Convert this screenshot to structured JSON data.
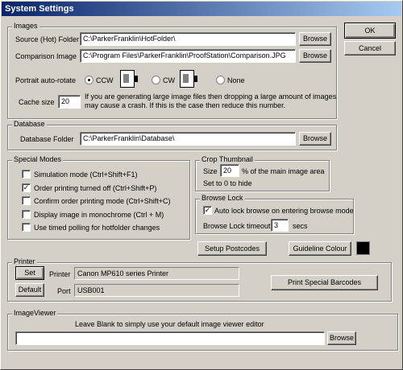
{
  "window": {
    "title": "System Settings"
  },
  "buttons": {
    "ok": "OK",
    "cancel": "Cancel",
    "browse": "Browse",
    "setup_postcodes": "Setup Postcodes",
    "guideline_colour": "Guideline Colour",
    "set": "Set",
    "default": "Default",
    "print_special_barcodes": "Print Special Barcodes"
  },
  "images": {
    "legend": "Images",
    "source_label": "Source (Hot) Folder",
    "source_value": "C:\\ParkerFranklin\\HotFolder\\",
    "comparison_label": "Comparison Image",
    "comparison_value": "C:\\Program Files\\ParkerFranklin\\ProofStation\\Comparison.JPG",
    "portrait_label": "Portrait auto-rotate",
    "rotate_options": [
      "CCW",
      "CW",
      "None"
    ],
    "rotate_selected": "CCW",
    "cache_label": "Cache size",
    "cache_value": "20",
    "cache_note_1": "If you are generating large image files then dropping a large amount of images",
    "cache_note_2": "may cause a crash. If this is the case then reduce this number."
  },
  "database": {
    "legend": "Database",
    "folder_label": "Database Folder",
    "folder_value": "C:\\ParkerFranklin\\Database\\"
  },
  "special_modes": {
    "legend": "Special Modes",
    "items": [
      {
        "label": "Simulation mode (Ctrl+Shift+F1)",
        "checked": false
      },
      {
        "label": "Order printing turned off (Ctrl+Shift+P)",
        "checked": true
      },
      {
        "label": "Confirm order printing mode (Ctrl+Shift+C)",
        "checked": false
      },
      {
        "label": "Display image in monochrome (Ctrl + M)",
        "checked": false
      },
      {
        "label": "Use timed polling for hotfolder changes",
        "checked": false
      }
    ]
  },
  "crop_thumbnail": {
    "legend": "Crop Thumbnail",
    "size_label": "Size",
    "size_value": "20",
    "size_suffix": "% of the main image area",
    "hint": "Set to 0 to hide"
  },
  "browse_lock": {
    "legend": "Browse Lock",
    "auto_lock_label": "Auto lock browse on entering browse mode",
    "auto_lock_checked": true,
    "timeout_label": "Browse Lock timeout",
    "timeout_value": "3",
    "timeout_unit": "secs"
  },
  "guideline_colour": {
    "swatch": "#000000"
  },
  "printer": {
    "legend": "Printer",
    "printer_label": "Printer",
    "printer_value": "Canon MP610 series Printer",
    "port_label": "Port",
    "port_value": "USB001"
  },
  "image_viewer": {
    "legend": "ImageViewer",
    "hint": "Leave Blank to simply use your default image viewer editor",
    "value": ""
  }
}
